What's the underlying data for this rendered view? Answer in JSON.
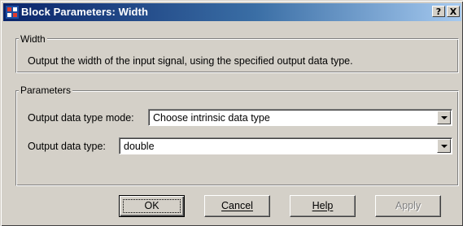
{
  "window": {
    "title": "Block Parameters: Width",
    "help_button": "?",
    "close_button": "X"
  },
  "width_group": {
    "label": "Width",
    "description": "Output the width of the input signal, using the specified output data type."
  },
  "parameters_group": {
    "label": "Parameters",
    "fields": [
      {
        "label": "Output data type mode:",
        "value": "Choose intrinsic data type"
      },
      {
        "label": "Output data type:",
        "value": "double"
      }
    ]
  },
  "buttons": {
    "ok": "OK",
    "cancel": "Cancel",
    "help": "Help",
    "apply": "Apply"
  }
}
